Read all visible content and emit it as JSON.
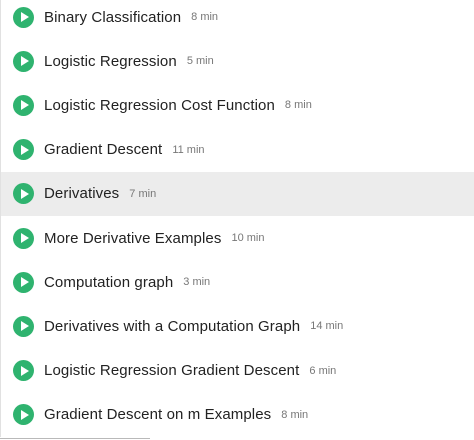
{
  "lessons": [
    {
      "title": "Binary Classification",
      "duration": "8 min"
    },
    {
      "title": "Logistic Regression",
      "duration": "5 min"
    },
    {
      "title": "Logistic Regression Cost Function",
      "duration": "8 min"
    },
    {
      "title": "Gradient Descent",
      "duration": "11 min"
    },
    {
      "title": "Derivatives",
      "duration": "7 min"
    },
    {
      "title": "More Derivative Examples",
      "duration": "10 min"
    },
    {
      "title": "Computation graph",
      "duration": "3 min"
    },
    {
      "title": "Derivatives with a Computation Graph",
      "duration": "14 min"
    },
    {
      "title": "Logistic Regression Gradient Descent",
      "duration": "6 min"
    },
    {
      "title": "Gradient Descent on m Examples",
      "duration": "8 min"
    }
  ],
  "icons": {
    "play": "play-circle-icon"
  },
  "colors": {
    "play_icon": "#2fb36f",
    "hover_row": "#ececec",
    "title_text": "#222222",
    "duration_text": "#777777"
  },
  "highlighted_index": 4
}
